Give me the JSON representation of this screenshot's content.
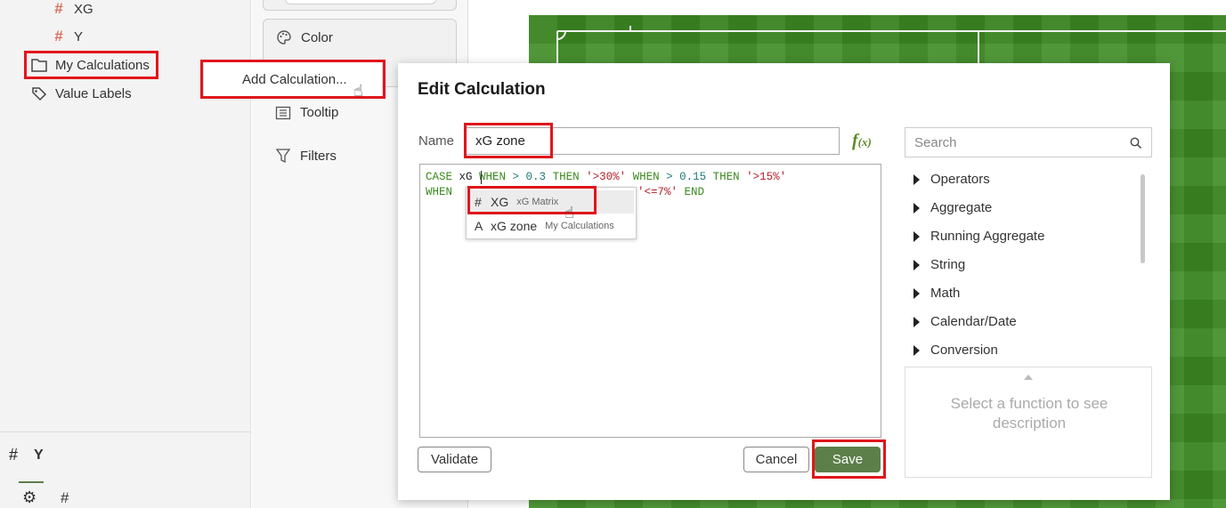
{
  "data_panel": {
    "items": [
      {
        "icon": "#",
        "label": "XG"
      },
      {
        "icon": "#",
        "label": "Y"
      },
      {
        "icon": "folder-icon",
        "label": "My Calculations"
      },
      {
        "icon": "tag-icon",
        "label": "Value Labels"
      }
    ],
    "footer_title": "Y",
    "footer_hash": "#"
  },
  "grammar": {
    "items": [
      {
        "icon": "palette-icon",
        "label": "Color"
      },
      {
        "icon": "tooltip-icon",
        "label": "Tooltip"
      },
      {
        "icon": "filter-icon",
        "label": "Filters"
      }
    ]
  },
  "context_menu": {
    "add_calculation": "Add Calculation..."
  },
  "dialog": {
    "title": "Edit Calculation",
    "name_label": "Name",
    "name_value": "xG zone",
    "fx_label": "f",
    "fx_sub": "(x)",
    "expression": {
      "line1": [
        {
          "t": "kw",
          "v": "CASE"
        },
        {
          "t": "plain",
          "v": " xG"
        },
        {
          "t": "kw",
          "v": " WHEN"
        },
        {
          "t": "num",
          "v": " > 0.3"
        },
        {
          "t": "kw",
          "v": " THEN"
        },
        {
          "t": "str",
          "v": " '>30%'"
        },
        {
          "t": "kw",
          "v": " WHEN"
        },
        {
          "t": "num",
          "v": " > 0.15"
        },
        {
          "t": "kw",
          "v": " THEN"
        },
        {
          "t": "str",
          "v": " '>15%'"
        }
      ],
      "line2_start": "WHEN",
      "line2_end_kw": "E",
      "line2_end_str": " '<=7%'",
      "line2_end": " END"
    },
    "autocomplete": [
      {
        "type": "#",
        "name": "XG",
        "source": "xG Matrix"
      },
      {
        "type": "A",
        "name": "xG zone",
        "source": "My Calculations"
      }
    ],
    "validate_label": "Validate",
    "cancel_label": "Cancel",
    "save_label": "Save",
    "search_placeholder": "Search",
    "function_categories": [
      "Operators",
      "Aggregate",
      "Running Aggregate",
      "String",
      "Math",
      "Calendar/Date",
      "Conversion"
    ],
    "description_placeholder": "Select a function to see description"
  },
  "colors": {
    "highlight_box": "#e0161c",
    "save_button": "#5c7f4a",
    "keyword": "#3b8a1d",
    "string": "#b31d28",
    "pitch": "#3d8b23"
  }
}
